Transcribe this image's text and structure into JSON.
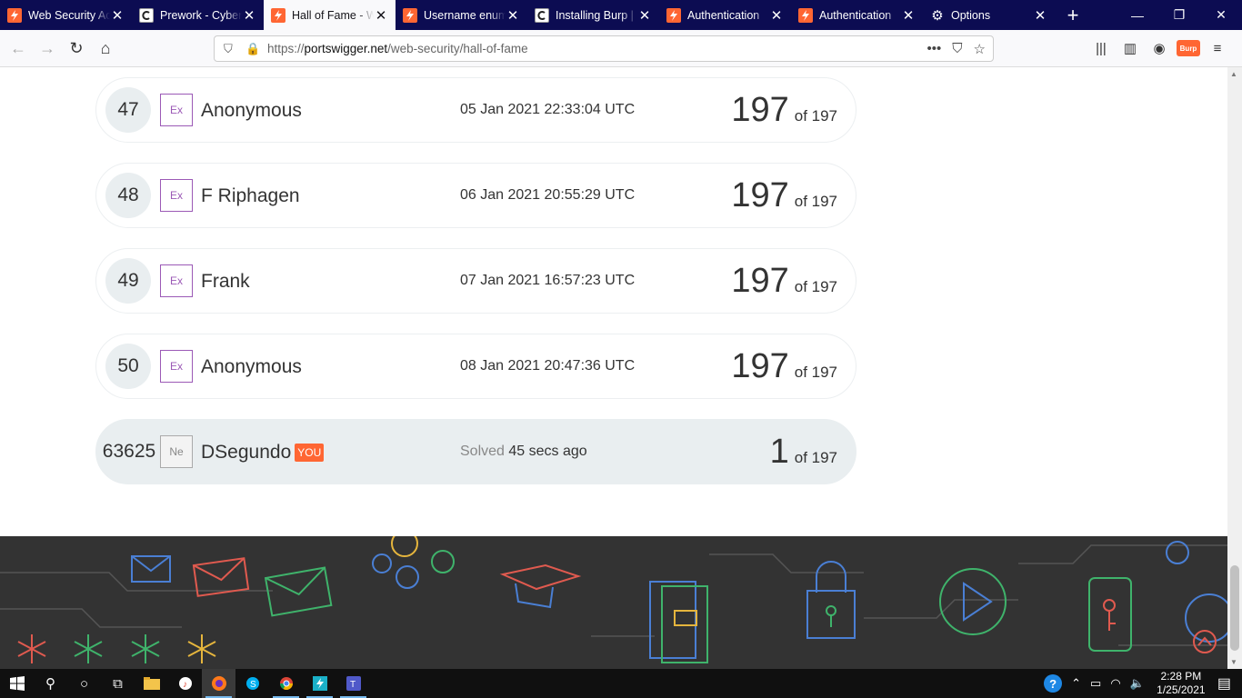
{
  "browser": {
    "tabs": [
      {
        "title": "Web Security Ac",
        "icon": "portswigger-icon",
        "active": false
      },
      {
        "title": "Prework - Cyber",
        "icon": "c-icon",
        "active": false
      },
      {
        "title": "Hall of Fame - W",
        "icon": "portswigger-icon",
        "active": true
      },
      {
        "title": "Username enum",
        "icon": "portswigger-icon",
        "active": false
      },
      {
        "title": "Installing Burp |",
        "icon": "c-icon",
        "active": false
      },
      {
        "title": "Authentication",
        "icon": "portswigger-icon",
        "active": false
      },
      {
        "title": "Authentication",
        "icon": "portswigger-icon",
        "active": false
      },
      {
        "title": "Options",
        "icon": "gear-icon",
        "active": false
      }
    ],
    "url_prefix": "https://",
    "url_domain": "portswigger.net",
    "url_path": "/web-security/hall-of-fame",
    "burp_label": "Burp"
  },
  "leaderboard": [
    {
      "rank": "47",
      "badge": "Ex",
      "name": "Anonymous",
      "date": "05 Jan 2021 22:33:04 UTC",
      "score": "197",
      "of": "of 197"
    },
    {
      "rank": "48",
      "badge": "Ex",
      "name": "F Riphagen",
      "date": "06 Jan 2021 20:55:29 UTC",
      "score": "197",
      "of": "of 197"
    },
    {
      "rank": "49",
      "badge": "Ex",
      "name": "Frank",
      "date": "07 Jan 2021 16:57:23 UTC",
      "score": "197",
      "of": "of 197"
    },
    {
      "rank": "50",
      "badge": "Ex",
      "name": "Anonymous",
      "date": "08 Jan 2021 20:47:36 UTC",
      "score": "197",
      "of": "of 197"
    }
  ],
  "you_row": {
    "rank": "63625",
    "badge": "Ne",
    "name": "DSegundo",
    "tag": "YOU",
    "solved_label": "Solved",
    "solved_time": "45 secs ago",
    "score": "1",
    "of": "of 197"
  },
  "taskbar": {
    "time": "2:28 PM",
    "date": "1/25/2021"
  },
  "colors": {
    "accent": "#ff6633",
    "badge_expert": "#9b59b6",
    "tabbar": "#0c0c52",
    "footer": "#333333"
  }
}
